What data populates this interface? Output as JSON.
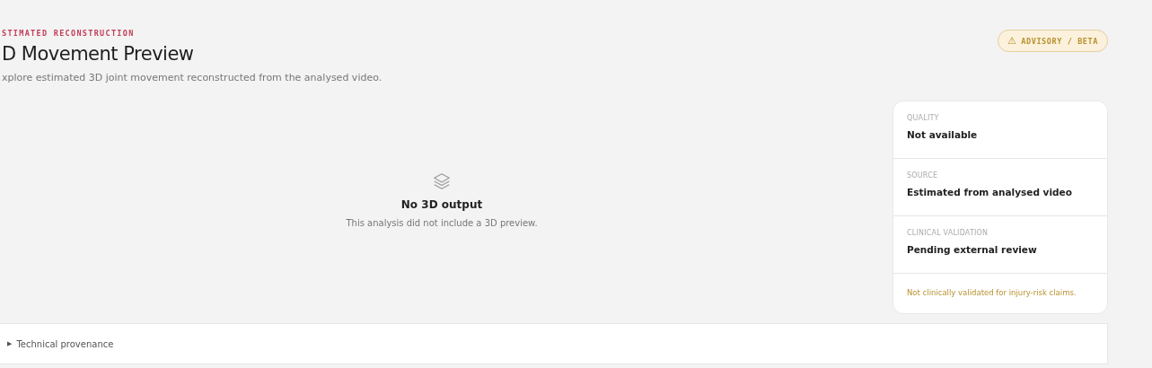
{
  "eyebrow": "STIMATED RECONSTRUCTION",
  "title": "D Movement Preview",
  "subtitle": "xplore estimated 3D joint movement reconstructed from the analysed video.",
  "badge": {
    "icon": "⚠",
    "label": "ADVISORY / BETA"
  },
  "empty_state": {
    "title": "No 3D output",
    "message": "This analysis did not include a 3D preview."
  },
  "info_card": {
    "items": [
      {
        "label": "QUALITY",
        "value": "Not available"
      },
      {
        "label": "SOURCE",
        "value": "Estimated from analysed video"
      },
      {
        "label": "CLINICAL VALIDATION",
        "value": "Pending external review"
      }
    ],
    "note": "Not clinically validated for injury-risk claims."
  },
  "details": {
    "marker": "▶",
    "label": "Technical provenance",
    "expanded": false
  }
}
